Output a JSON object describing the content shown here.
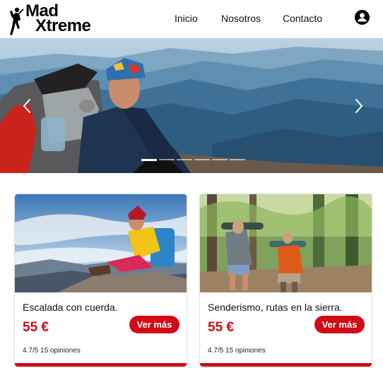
{
  "header": {
    "logo_line1": "Mad",
    "logo_line2": "Xtreme",
    "nav": [
      "Inicio",
      "Nosotros",
      "Contacto"
    ],
    "user_icon": "user-circle-icon"
  },
  "hero": {
    "prev_icon": "chevron-left-icon",
    "next_icon": "chevron-right-icon",
    "slide_count": 6,
    "active_slide": 1
  },
  "cards": [
    {
      "title": "Escalada con cuerda.",
      "price": "55 €",
      "button": "Ver más",
      "rating": "4.7/5 15 opiniones"
    },
    {
      "title": "Senderismo, rutas en la sierra.",
      "price": "55 €",
      "button": "Ver más",
      "rating": "4.7/5 15 opiniones"
    }
  ],
  "colors": {
    "accent": "#d10a14",
    "text": "#111111"
  }
}
